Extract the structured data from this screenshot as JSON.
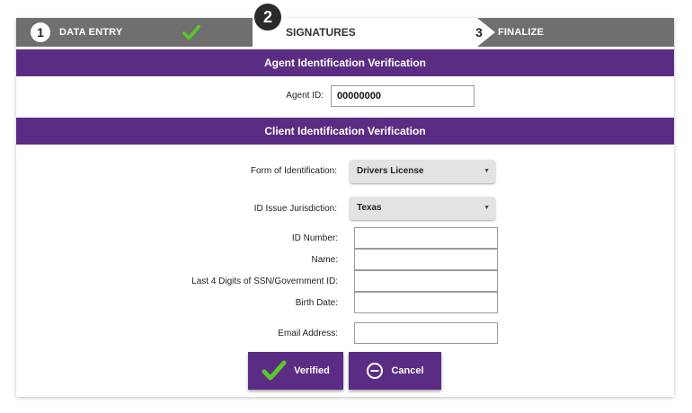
{
  "stepper": {
    "steps": [
      {
        "number": "1",
        "label": "DATA ENTRY"
      },
      {
        "number": "2",
        "label": "SIGNATURES"
      },
      {
        "number": "3",
        "label": "FINALIZE"
      }
    ]
  },
  "agent_section": {
    "title": "Agent Identification Verification",
    "agent_id_label": "Agent ID:",
    "agent_id_value": "00000000"
  },
  "client_section": {
    "title": "Client Identification Verification",
    "form_of_id_label": "Form of Identification:",
    "form_of_id_value": "Drivers License",
    "jurisdiction_label": "ID Issue Jurisdiction:",
    "jurisdiction_value": "Texas",
    "id_number_label": "ID Number:",
    "name_label": "Name:",
    "ssn_label": "Last 4 Digits of SSN/Government ID:",
    "birth_date_label": "Birth Date:",
    "email_label": "Email Address:"
  },
  "actions": {
    "verified_label": "Verified",
    "cancel_label": "Cancel"
  },
  "colors": {
    "brand_purple": "#5b2c83",
    "stepper_gray": "#6f6f6f",
    "check_green": "#5cc72b"
  },
  "icons": {
    "step_complete": "check-icon",
    "verified": "check-icon",
    "cancel": "minus-circle-icon",
    "select_caret": "caret-down-icon"
  }
}
